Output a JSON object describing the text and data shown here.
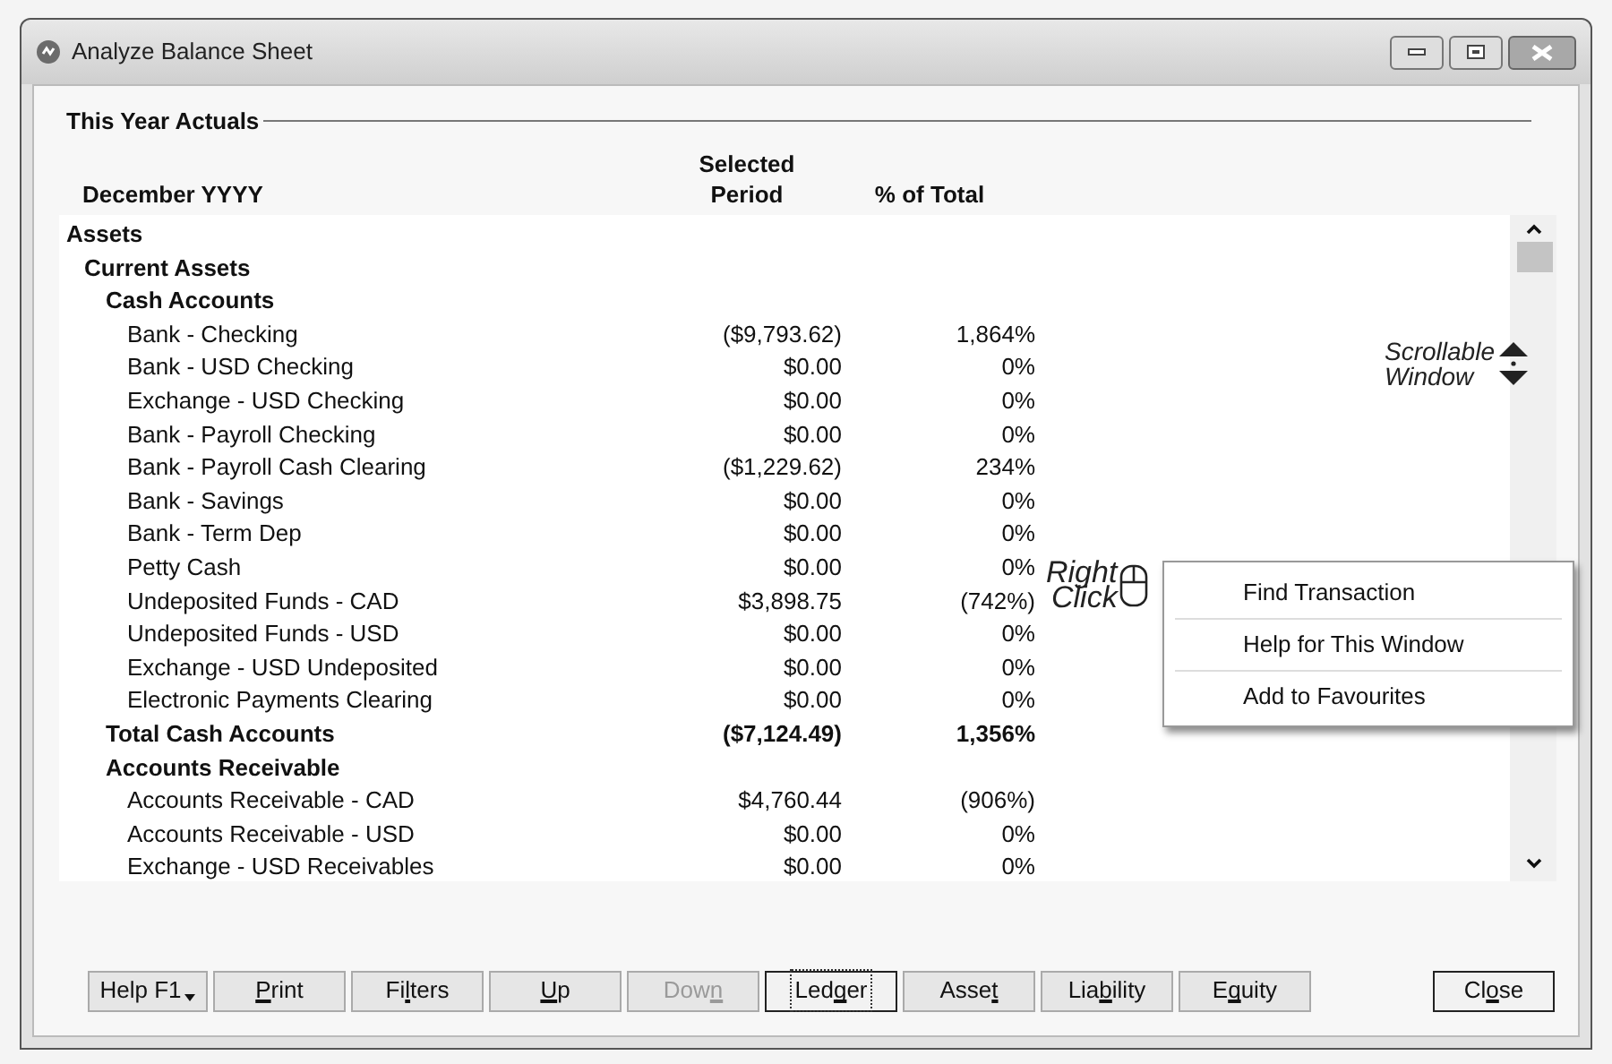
{
  "window": {
    "title": "Analyze Balance Sheet"
  },
  "group_label": "This Year Actuals",
  "table": {
    "columns": [
      {
        "label": "December YYYY"
      },
      {
        "label": "Selected Period"
      },
      {
        "label": "% of Total"
      }
    ],
    "rows": [
      {
        "kind": "heading",
        "name": "Assets",
        "children": [
          {
            "kind": "heading",
            "name": "Current Assets",
            "children": [
              {
                "kind": "heading",
                "name": "Cash Accounts",
                "children": [
                  {
                    "kind": "account",
                    "name": "Bank - Checking",
                    "amount": "($9,793.62)",
                    "percent": "1,864%"
                  },
                  {
                    "kind": "account",
                    "name": "Bank - USD Checking",
                    "amount": "$0.00",
                    "percent": "0%"
                  },
                  {
                    "kind": "account",
                    "name": "Exchange - USD Checking",
                    "amount": "$0.00",
                    "percent": "0%"
                  },
                  {
                    "kind": "account",
                    "name": "Bank - Payroll Checking",
                    "amount": "$0.00",
                    "percent": "0%"
                  },
                  {
                    "kind": "account",
                    "name": "Bank - Payroll Cash Clearing",
                    "amount": "($1,229.62)",
                    "percent": "234%"
                  },
                  {
                    "kind": "account",
                    "name": "Bank - Savings",
                    "amount": "$0.00",
                    "percent": "0%"
                  },
                  {
                    "kind": "account",
                    "name": "Bank - Term Dep",
                    "amount": "$0.00",
                    "percent": "0%"
                  },
                  {
                    "kind": "account",
                    "name": "Petty Cash",
                    "amount": "$0.00",
                    "percent": "0%"
                  },
                  {
                    "kind": "account",
                    "name": "Undeposited Funds - CAD",
                    "amount": "$3,898.75",
                    "percent": "(742%)"
                  },
                  {
                    "kind": "account",
                    "name": "Undeposited Funds - USD",
                    "amount": "$0.00",
                    "percent": "0%"
                  },
                  {
                    "kind": "account",
                    "name": "Exchange - USD Undeposited",
                    "amount": "$0.00",
                    "percent": "0%"
                  },
                  {
                    "kind": "account",
                    "name": "Electronic Payments Clearing",
                    "amount": "$0.00",
                    "percent": "0%"
                  }
                ]
              },
              {
                "kind": "total",
                "name": "Total Cash Accounts",
                "amount": "($7,124.49)",
                "percent": "1,356%"
              },
              {
                "kind": "heading",
                "name": "Accounts Receivable",
                "children": [
                  {
                    "kind": "account",
                    "name": "Accounts Receivable - CAD",
                    "amount": "$4,760.44",
                    "percent": "(906%)"
                  },
                  {
                    "kind": "account",
                    "name": "Accounts Receivable - USD",
                    "amount": "$0.00",
                    "percent": "0%"
                  },
                  {
                    "kind": "account",
                    "name": "Exchange - USD Receivables",
                    "amount": "$0.00",
                    "percent": "0%"
                  }
                ]
              }
            ]
          }
        ]
      }
    ]
  },
  "scroll_note": {
    "lines": [
      "Scrollable",
      "Window"
    ]
  },
  "right_click_note": {
    "lines": [
      "Right",
      "Click"
    ]
  },
  "context_menu": {
    "items": [
      "Find Transaction",
      "Help for This Window",
      "Add to Favourites"
    ]
  },
  "buttons": [
    {
      "parts": [
        {
          "text": "Help F1",
          "underlined": false
        }
      ],
      "kind": "dropdown",
      "disabled": false,
      "focused": false,
      "default": false
    },
    {
      "parts": [
        {
          "text": "P",
          "underlined": true
        },
        {
          "text": "rint",
          "underlined": false
        }
      ],
      "kind": "plain",
      "disabled": false,
      "focused": false,
      "default": false
    },
    {
      "parts": [
        {
          "text": "Fi",
          "underlined": false
        },
        {
          "text": "l",
          "underlined": true
        },
        {
          "text": "ters",
          "underlined": false
        }
      ],
      "kind": "plain",
      "disabled": false,
      "focused": false,
      "default": false
    },
    {
      "parts": [
        {
          "text": "U",
          "underlined": true
        },
        {
          "text": "p",
          "underlined": false
        }
      ],
      "kind": "plain",
      "disabled": false,
      "focused": false,
      "default": false
    },
    {
      "parts": [
        {
          "text": "Dow",
          "underlined": false
        },
        {
          "text": "n",
          "underlined": true
        }
      ],
      "kind": "plain",
      "disabled": true,
      "focused": false,
      "default": false
    },
    {
      "parts": [
        {
          "text": "Led",
          "underlined": false
        },
        {
          "text": "g",
          "underlined": true
        },
        {
          "text": "er",
          "underlined": false
        }
      ],
      "kind": "plain",
      "disabled": false,
      "focused": true,
      "default": false
    },
    {
      "parts": [
        {
          "text": "Asse",
          "underlined": false
        },
        {
          "text": "t",
          "underlined": true
        }
      ],
      "kind": "plain",
      "disabled": false,
      "focused": false,
      "default": false
    },
    {
      "parts": [
        {
          "text": "Lia",
          "underlined": false
        },
        {
          "text": "b",
          "underlined": true
        },
        {
          "text": "ility",
          "underlined": false
        }
      ],
      "kind": "plain",
      "disabled": false,
      "focused": false,
      "default": false
    },
    {
      "parts": [
        {
          "text": "E",
          "underlined": false
        },
        {
          "text": "q",
          "underlined": true
        },
        {
          "text": "uity",
          "underlined": false
        }
      ],
      "kind": "plain",
      "disabled": false,
      "focused": false,
      "default": false
    },
    {
      "parts": [
        {
          "text": "Cl",
          "underlined": false
        },
        {
          "text": "o",
          "underlined": true
        },
        {
          "text": "se",
          "underlined": false
        }
      ],
      "kind": "plain",
      "disabled": false,
      "focused": false,
      "default": true
    }
  ]
}
